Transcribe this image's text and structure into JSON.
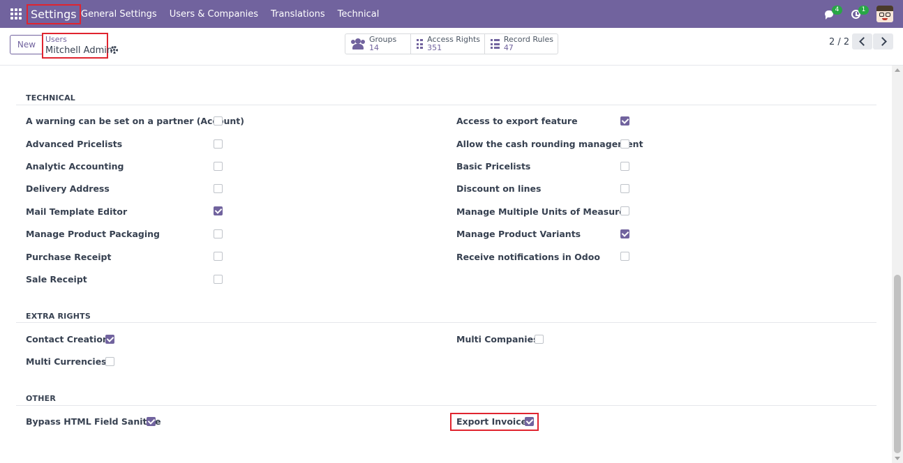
{
  "navbar": {
    "brand": "Settings",
    "menu": [
      "General Settings",
      "Users & Companies",
      "Translations",
      "Technical"
    ],
    "messages_badge": "4",
    "activities_badge": "1",
    "accent_color": "#71639e"
  },
  "control_panel": {
    "new_label": "New",
    "breadcrumb_parent": "Users",
    "breadcrumb_current": "Mitchell Admin",
    "stats": [
      {
        "label": "Groups",
        "value": "14",
        "icon": "users-icon"
      },
      {
        "label": "Access Rights",
        "value": "351",
        "icon": "list-icon"
      },
      {
        "label": "Record Rules",
        "value": "47",
        "icon": "list-icon"
      }
    ],
    "pager": "2 / 2"
  },
  "sections": [
    {
      "title": "TECHNICAL",
      "left": [
        {
          "label": "A warning can be set on a partner (Account)",
          "checked": false
        },
        {
          "label": "Advanced Pricelists",
          "checked": false
        },
        {
          "label": "Analytic Accounting",
          "checked": false
        },
        {
          "label": "Delivery Address",
          "checked": false
        },
        {
          "label": "Mail Template Editor",
          "checked": true
        },
        {
          "label": "Manage Product Packaging",
          "checked": false
        },
        {
          "label": "Purchase Receipt",
          "checked": false
        },
        {
          "label": "Sale Receipt",
          "checked": false
        }
      ],
      "right": [
        {
          "label": "Access to export feature",
          "checked": true
        },
        {
          "label": "Allow the cash rounding management",
          "checked": false
        },
        {
          "label": "Basic Pricelists",
          "checked": false
        },
        {
          "label": "Discount on lines",
          "checked": false
        },
        {
          "label": "Manage Multiple Units of Measure",
          "checked": false
        },
        {
          "label": "Manage Product Variants",
          "checked": true
        },
        {
          "label": "Receive notifications in Odoo",
          "checked": false
        }
      ]
    },
    {
      "title": "EXTRA RIGHTS",
      "left": [
        {
          "label": "Contact Creation",
          "checked": true
        },
        {
          "label": "Multi Currencies",
          "checked": false
        }
      ],
      "right": [
        {
          "label": "Multi Companies",
          "checked": false
        }
      ]
    },
    {
      "title": "OTHER",
      "left": [
        {
          "label": "Bypass HTML Field Sanitize",
          "checked": true
        }
      ],
      "right": [
        {
          "label": "Export Invoice",
          "checked": true
        }
      ]
    }
  ]
}
